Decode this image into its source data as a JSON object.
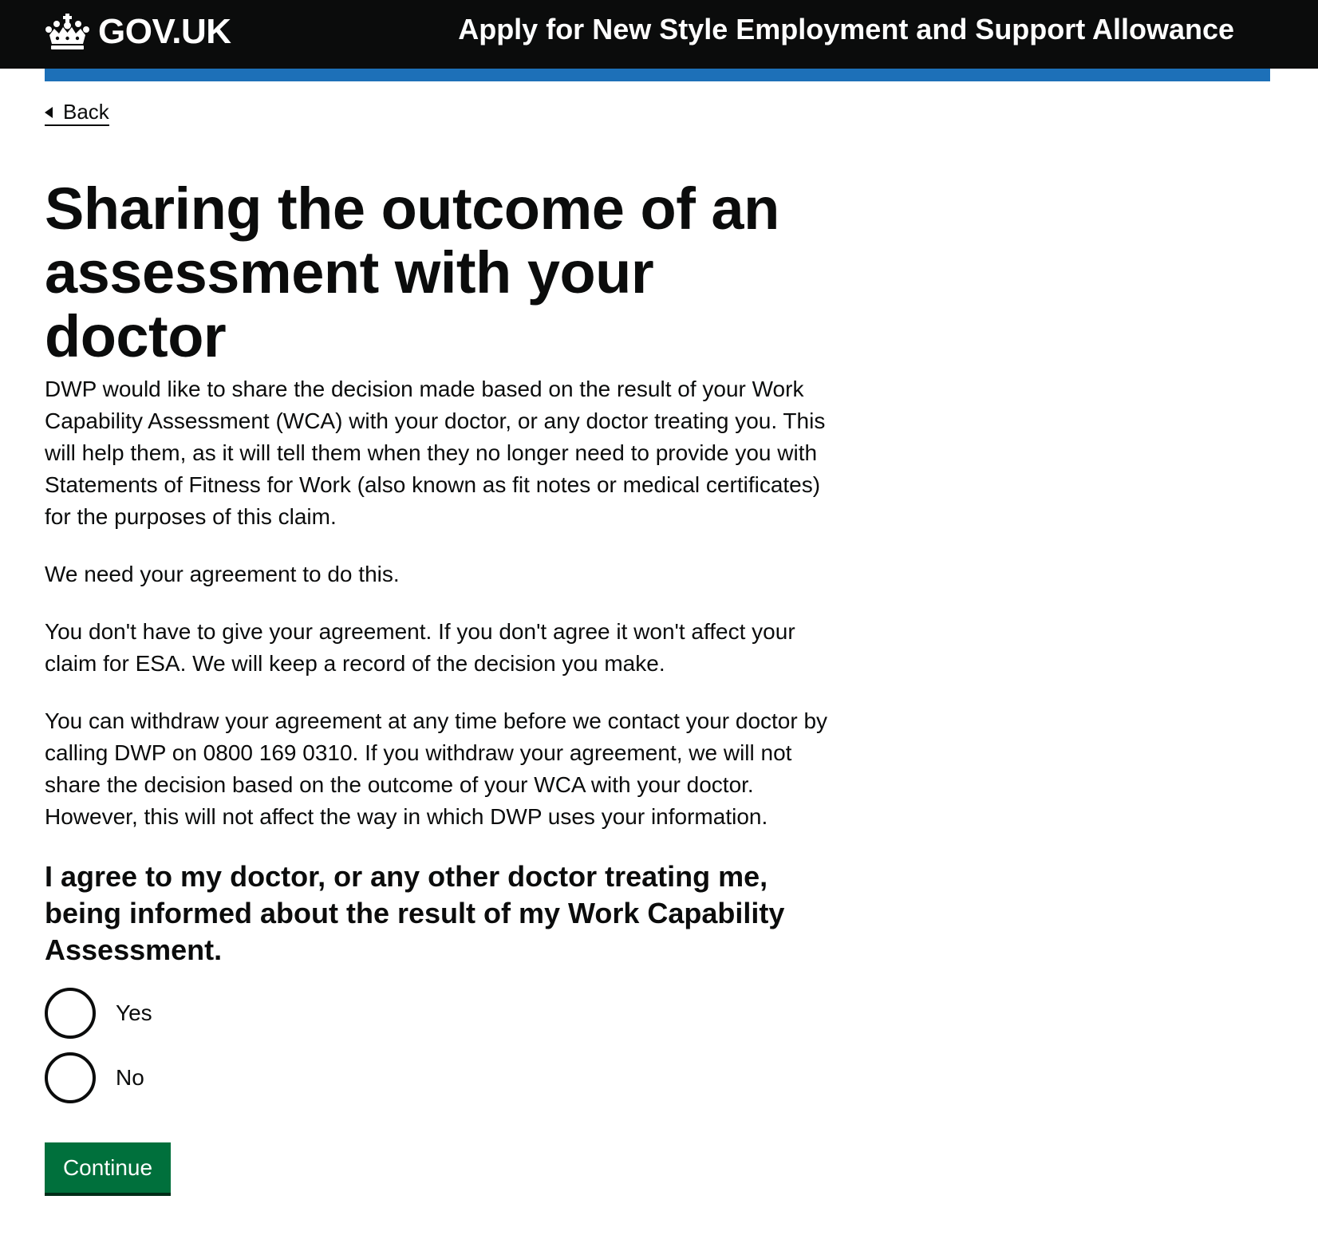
{
  "header": {
    "logo_text": "GOV.UK",
    "logo_icon": "crown-icon",
    "service_name": "Apply for New Style Employment and Support Allowance"
  },
  "nav": {
    "back_label": "Back"
  },
  "main": {
    "title": "Sharing the outcome of an assessment with your doctor",
    "paragraphs": [
      "DWP would like to share the decision made based on the result of your Work Capability Assessment (WCA) with your doctor, or any doctor treating you. This will help them, as it will tell them when they no longer need to provide you with Statements of Fitness for Work (also known as fit notes or medical certificates) for the purposes of this claim.",
      "We need your agreement to do this.",
      "You don't have to give your agreement. If you don't agree it won't affect your claim for ESA. We will keep a record of the decision you make.",
      "You can withdraw your agreement at any time before we contact your doctor by calling DWP on 0800 169 0310. If you withdraw your agreement, we will not share the decision based on the outcome of your WCA with your doctor. However, this will not affect the way in which DWP uses your information."
    ],
    "question": "I agree to my doctor, or any other doctor treating me, being informed about the result of my Work Capability Assessment.",
    "options": [
      {
        "label": "Yes",
        "selected": false
      },
      {
        "label": "No",
        "selected": false
      }
    ],
    "continue_label": "Continue"
  },
  "colors": {
    "header_bg": "#0b0c0c",
    "accent_bar": "#1d70b8",
    "button_green": "#00703c",
    "text": "#0b0c0c"
  }
}
